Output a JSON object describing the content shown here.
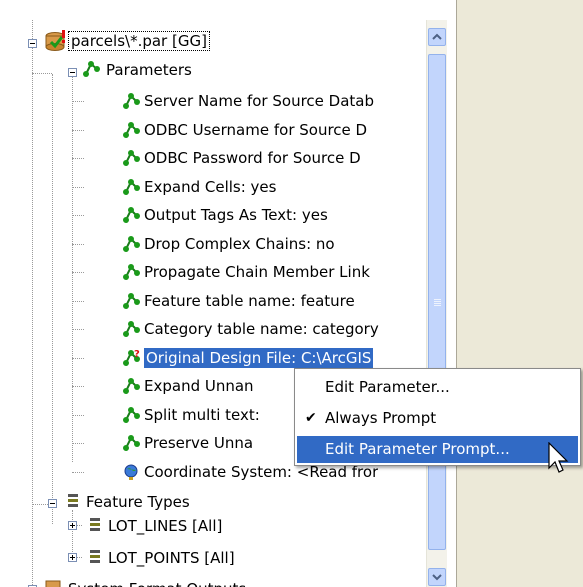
{
  "tree": {
    "root": {
      "label": "parcels\\*.par [GG]"
    },
    "parameters": {
      "label": "Parameters",
      "items": [
        {
          "label": "Server Name for Source Datab",
          "icon": "parameter-icon"
        },
        {
          "label": "ODBC Username for Source D",
          "icon": "parameter-icon"
        },
        {
          "label": "ODBC Password for Source D",
          "icon": "parameter-icon"
        },
        {
          "label": "Expand Cells: yes",
          "icon": "parameter-icon"
        },
        {
          "label": "Output Tags As Text: yes",
          "icon": "parameter-icon"
        },
        {
          "label": "Drop Complex Chains: no",
          "icon": "parameter-icon"
        },
        {
          "label": "Propagate Chain Member Link",
          "icon": "parameter-icon"
        },
        {
          "label": "Feature table name: feature",
          "icon": "parameter-icon"
        },
        {
          "label": "Category table name: category",
          "icon": "parameter-icon"
        },
        {
          "label": "Original Design File: C:\\ArcGIS",
          "icon": "parameter-prompt-icon"
        },
        {
          "label": "Expand Unnan",
          "icon": "parameter-icon"
        },
        {
          "label": "Split multi text:",
          "icon": "parameter-icon"
        },
        {
          "label": "Preserve Unna",
          "icon": "parameter-icon"
        },
        {
          "label": "Coordinate System: <Read fror",
          "icon": "globe-icon"
        }
      ]
    },
    "feature_types": {
      "label": "Feature Types",
      "items": [
        {
          "label": "LOT_LINES [All]"
        },
        {
          "label": "LOT_POINTS [All]"
        }
      ]
    },
    "partial_bottom": {
      "label": "System Format Outputs"
    }
  },
  "context_menu": {
    "items": [
      {
        "label": "Edit Parameter...",
        "checked": false,
        "highlighted": false
      },
      {
        "label": "Always Prompt",
        "checked": true,
        "highlighted": false
      },
      {
        "label": "Edit Parameter Prompt...",
        "checked": false,
        "highlighted": true
      }
    ]
  },
  "colors": {
    "selection": "#316ac5",
    "scrollbar_track": "#f3f2ea",
    "scrollbar_thumb": "#c2d5fc",
    "menu_bg": "#ffffff",
    "panel_border": "#7f9db9",
    "parameter_icon": "#1a9a1a",
    "warning_mark": "#e01010"
  }
}
